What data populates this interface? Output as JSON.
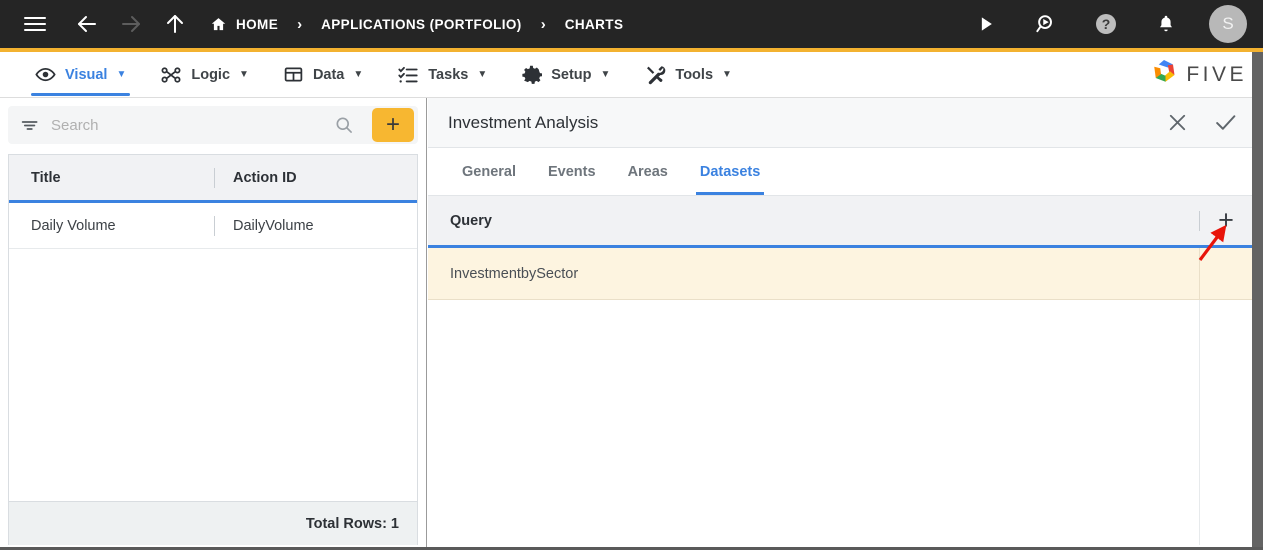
{
  "topbar": {
    "menu_label": "menu",
    "back_label": "back",
    "forward_label": "forward",
    "up_label": "up",
    "breadcrumbs": [
      {
        "label": "HOME",
        "icon": "home-icon"
      },
      {
        "label": "APPLICATIONS (PORTFOLIO)",
        "icon": ""
      },
      {
        "label": "CHARTS",
        "icon": ""
      }
    ],
    "separator": "›",
    "actions": [
      {
        "name": "run-icon",
        "glyph": "▶"
      },
      {
        "name": "search-run-icon",
        "glyph": ""
      },
      {
        "name": "help-icon",
        "glyph": "?"
      },
      {
        "name": "notifications-icon",
        "glyph": ""
      }
    ],
    "avatar_initial": "S"
  },
  "modulebar": {
    "tabs": [
      {
        "label": "Visual",
        "icon": "eye-icon",
        "active": true,
        "caret": "▼"
      },
      {
        "label": "Logic",
        "icon": "logic-icon",
        "active": false,
        "caret": "▼"
      },
      {
        "label": "Data",
        "icon": "table-icon",
        "active": false,
        "caret": "▼"
      },
      {
        "label": "Tasks",
        "icon": "checklist-icon",
        "active": false,
        "caret": "▼"
      },
      {
        "label": "Setup",
        "icon": "gear-icon",
        "active": false,
        "caret": "▼"
      },
      {
        "label": "Tools",
        "icon": "tools-icon",
        "active": false,
        "caret": "▼"
      }
    ],
    "brand": "FIVE"
  },
  "left_pane": {
    "search": {
      "placeholder": "Search",
      "value": "",
      "filter_icon": "filter-icon",
      "search_icon": "search-icon",
      "add_label": "+"
    },
    "grid": {
      "columns": [
        "Title",
        "Action ID"
      ],
      "rows": [
        {
          "title": "Daily Volume",
          "action_id": "DailyVolume"
        }
      ],
      "footer": "Total Rows: 1"
    }
  },
  "right_pane": {
    "title": "Investment Analysis",
    "close_label": "close",
    "confirm_label": "confirm",
    "tabs": [
      {
        "label": "General",
        "active": false
      },
      {
        "label": "Events",
        "active": false
      },
      {
        "label": "Areas",
        "active": false
      },
      {
        "label": "Datasets",
        "active": true
      }
    ],
    "datasets_grid": {
      "column": "Query",
      "add_label": "+",
      "rows": [
        {
          "query": "InvestmentbySector"
        }
      ]
    }
  },
  "colors": {
    "topbar_bg": "#252525",
    "accent_amber": "#f3b230",
    "accent_blue": "#3b82e0",
    "row_highlight": "#fdf4e0",
    "annotation_arrow": "#e8140a"
  }
}
